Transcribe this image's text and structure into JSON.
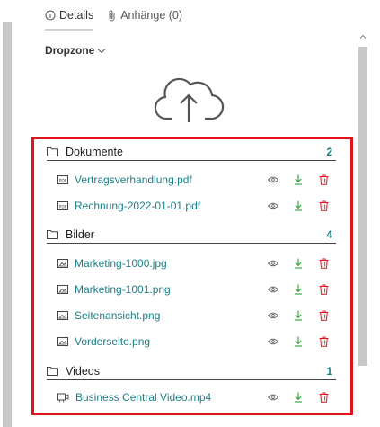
{
  "tabs": [
    {
      "label": "Details",
      "icon": "info-icon",
      "active": true
    },
    {
      "label": "Anhänge (0)",
      "icon": "paperclip-icon",
      "active": false
    }
  ],
  "dropzone": {
    "label": "Dropzone",
    "icon": "cloud-upload-icon"
  },
  "groups": [
    {
      "name": "Dokumente",
      "count": "2",
      "icon": "folder-icon",
      "files": [
        {
          "name": "Vertragsverhandlung.pdf",
          "icon": "pdf-file-icon"
        },
        {
          "name": "Rechnung-2022-01-01.pdf",
          "icon": "pdf-file-icon"
        }
      ]
    },
    {
      "name": "Bilder",
      "count": "4",
      "icon": "folder-icon",
      "files": [
        {
          "name": "Marketing-1000.jpg",
          "icon": "image-file-icon"
        },
        {
          "name": "Marketing-1001.png",
          "icon": "image-file-icon"
        },
        {
          "name": "Seitenansicht.png",
          "icon": "image-file-icon"
        },
        {
          "name": "Vorderseite.png",
          "icon": "image-file-icon"
        }
      ]
    },
    {
      "name": "Videos",
      "count": "1",
      "icon": "folder-icon",
      "files": [
        {
          "name": "Business Central Video.mp4",
          "icon": "video-file-icon"
        }
      ]
    }
  ],
  "colors": {
    "highlight": "#e0121b",
    "link": "#1b7f88",
    "download": "#2e9e3a",
    "delete": "#e0121b",
    "count": "#1a8080"
  }
}
